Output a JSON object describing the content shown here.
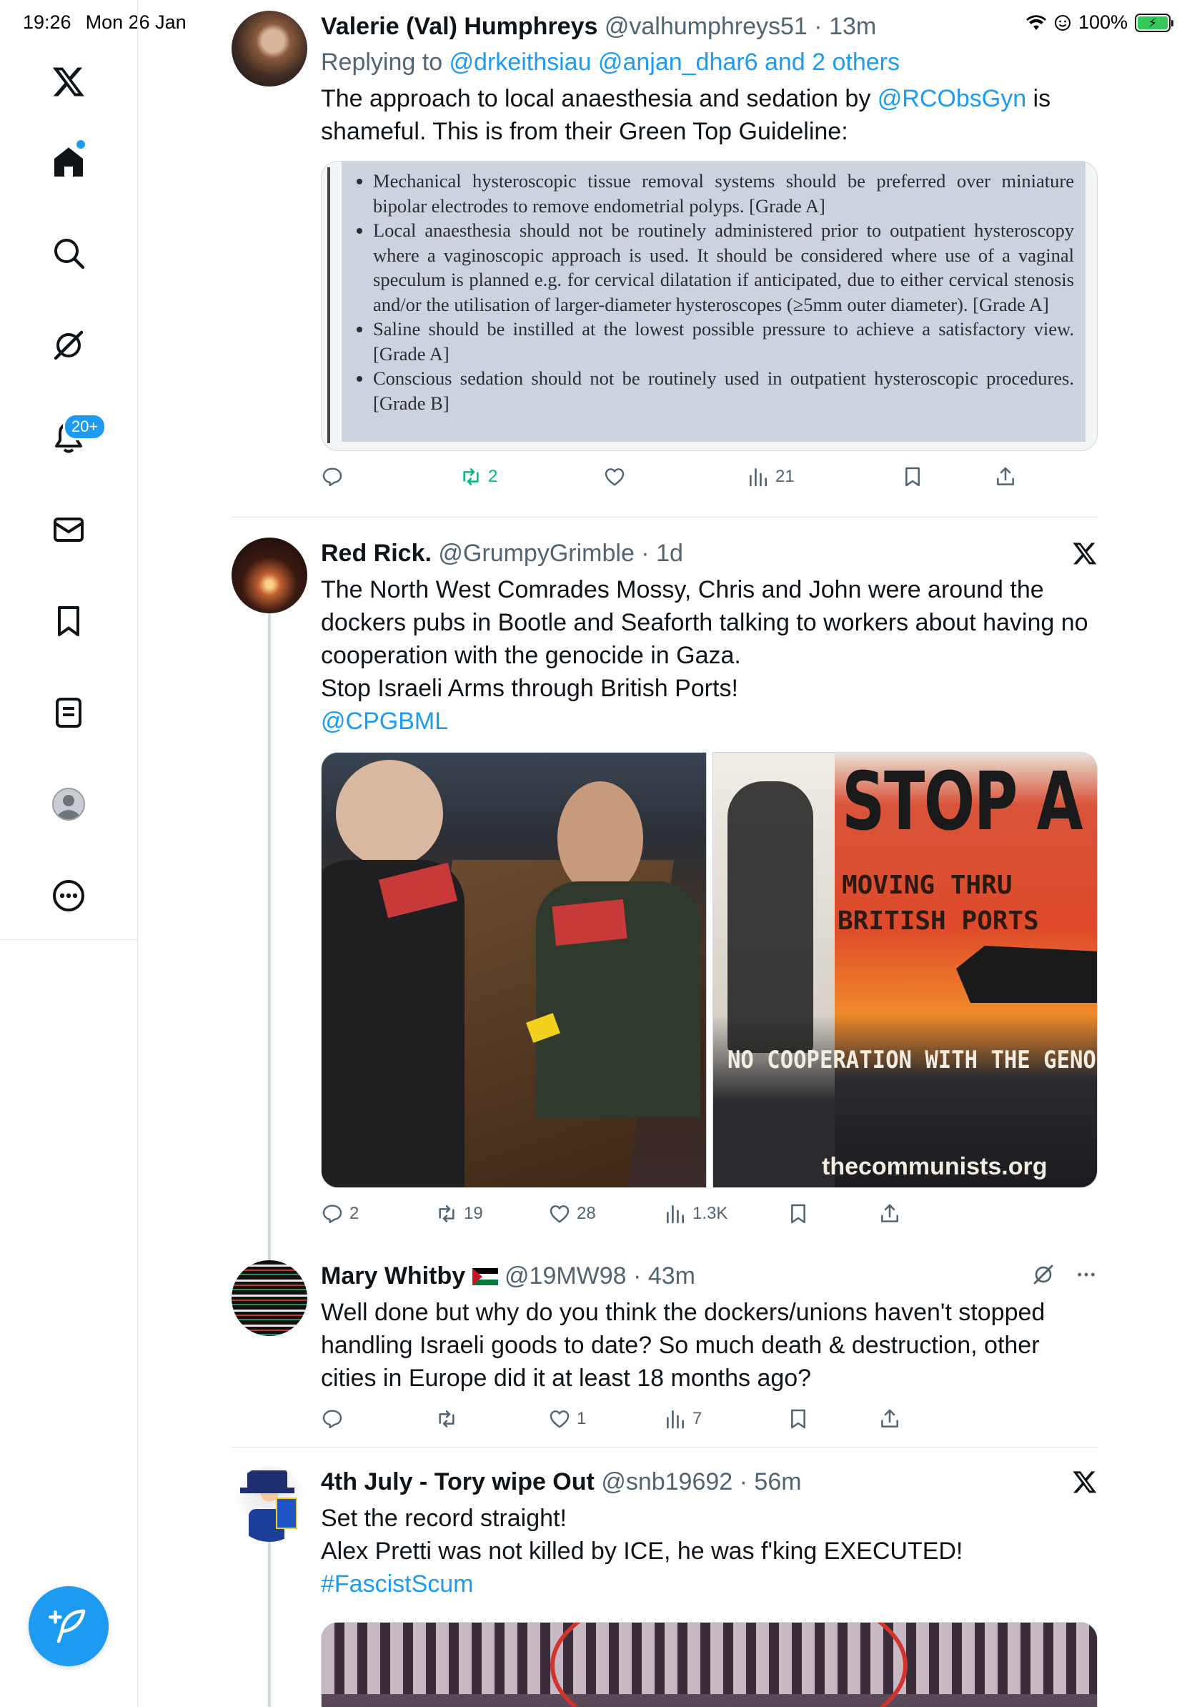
{
  "status_bar": {
    "time": "19:26",
    "date": "Mon 26 Jan",
    "battery": "100%"
  },
  "sidebar": {
    "items": [
      "x-logo",
      "home",
      "search",
      "grok",
      "notifications",
      "messages",
      "bookmarks",
      "lists",
      "profile",
      "more"
    ],
    "notifications_badge": "20+"
  },
  "colors": {
    "accent": "#1d9bf0",
    "retweet_green": "#00ba7c",
    "text": "#0f1419",
    "muted": "#536471"
  },
  "tweets": [
    {
      "name": "Valerie (Val) Humphreys",
      "handle": "@valhumphreys51",
      "time": "13m",
      "replying_prefix": "Replying to ",
      "replying_to": "@drkeithsiau @anjan_dhar6 and 2 others",
      "text_before": "The approach to local anaesthesia and sedation by ",
      "mention": "@RCObsGyn",
      "text_after": " is shameful. This is from their Green Top Guideline:",
      "guideline_bullets": [
        "Mechanical hysteroscopic tissue removal systems should be preferred over miniature bipolar electrodes to remove endometrial polyps. [Grade A]",
        "Local anaesthesia should not be routinely administered prior to outpatient hysteroscopy where a vaginoscopic approach is used. It should be considered where use of a vaginal speculum is planned e.g. for cervical dilatation if anticipated, due to either cervical stenosis and/or the utilisation of larger-diameter hysteroscopes (≥5mm outer diameter). [Grade A]",
        "Saline should be instilled at the lowest possible pressure to achieve a satisfactory view. [Grade A]",
        "Conscious sedation should not be routinely used in outpatient hysteroscopic procedures. [Grade B]"
      ],
      "replies": "",
      "retweets": "2",
      "likes": "",
      "views": "21"
    },
    {
      "name": "Red Rick.",
      "handle": "@GrumpyGrimble",
      "time": "1d",
      "lines": [
        "The North West Comrades Mossy, Chris and John were around the dockers pubs in Bootle and Seaforth talking to workers about having no cooperation with the genocide in Gaza.",
        "Stop Israeli Arms through British Ports!"
      ],
      "mention": "@CPGBML",
      "poster": {
        "headline": "STOP A",
        "sub1": "MOVING THRU",
        "sub2": "BRITISH PORTS",
        "footer": "NO COOPERATION WITH THE GENOC",
        "site": "thecommunists.org"
      },
      "replies": "2",
      "retweets": "19",
      "likes": "28",
      "views": "1.3K"
    },
    {
      "name": "Mary Whitby",
      "handle": "@19MW98",
      "time": "43m",
      "text": "Well done but why do you think the dockers/unions haven't stopped handling Israeli goods to date? So much death & destruction, other cities in Europe did it at least 18 months ago?",
      "replies": "",
      "retweets": "",
      "likes": "1",
      "views": "7"
    },
    {
      "name": "4th July - Tory wipe Out",
      "handle": "@snb19692",
      "time": "56m",
      "lines": [
        "Set the record straight!",
        "Alex Pretti was not killed by ICE, he was f'king EXECUTED!"
      ],
      "hashtag": "#FascistScum"
    }
  ]
}
